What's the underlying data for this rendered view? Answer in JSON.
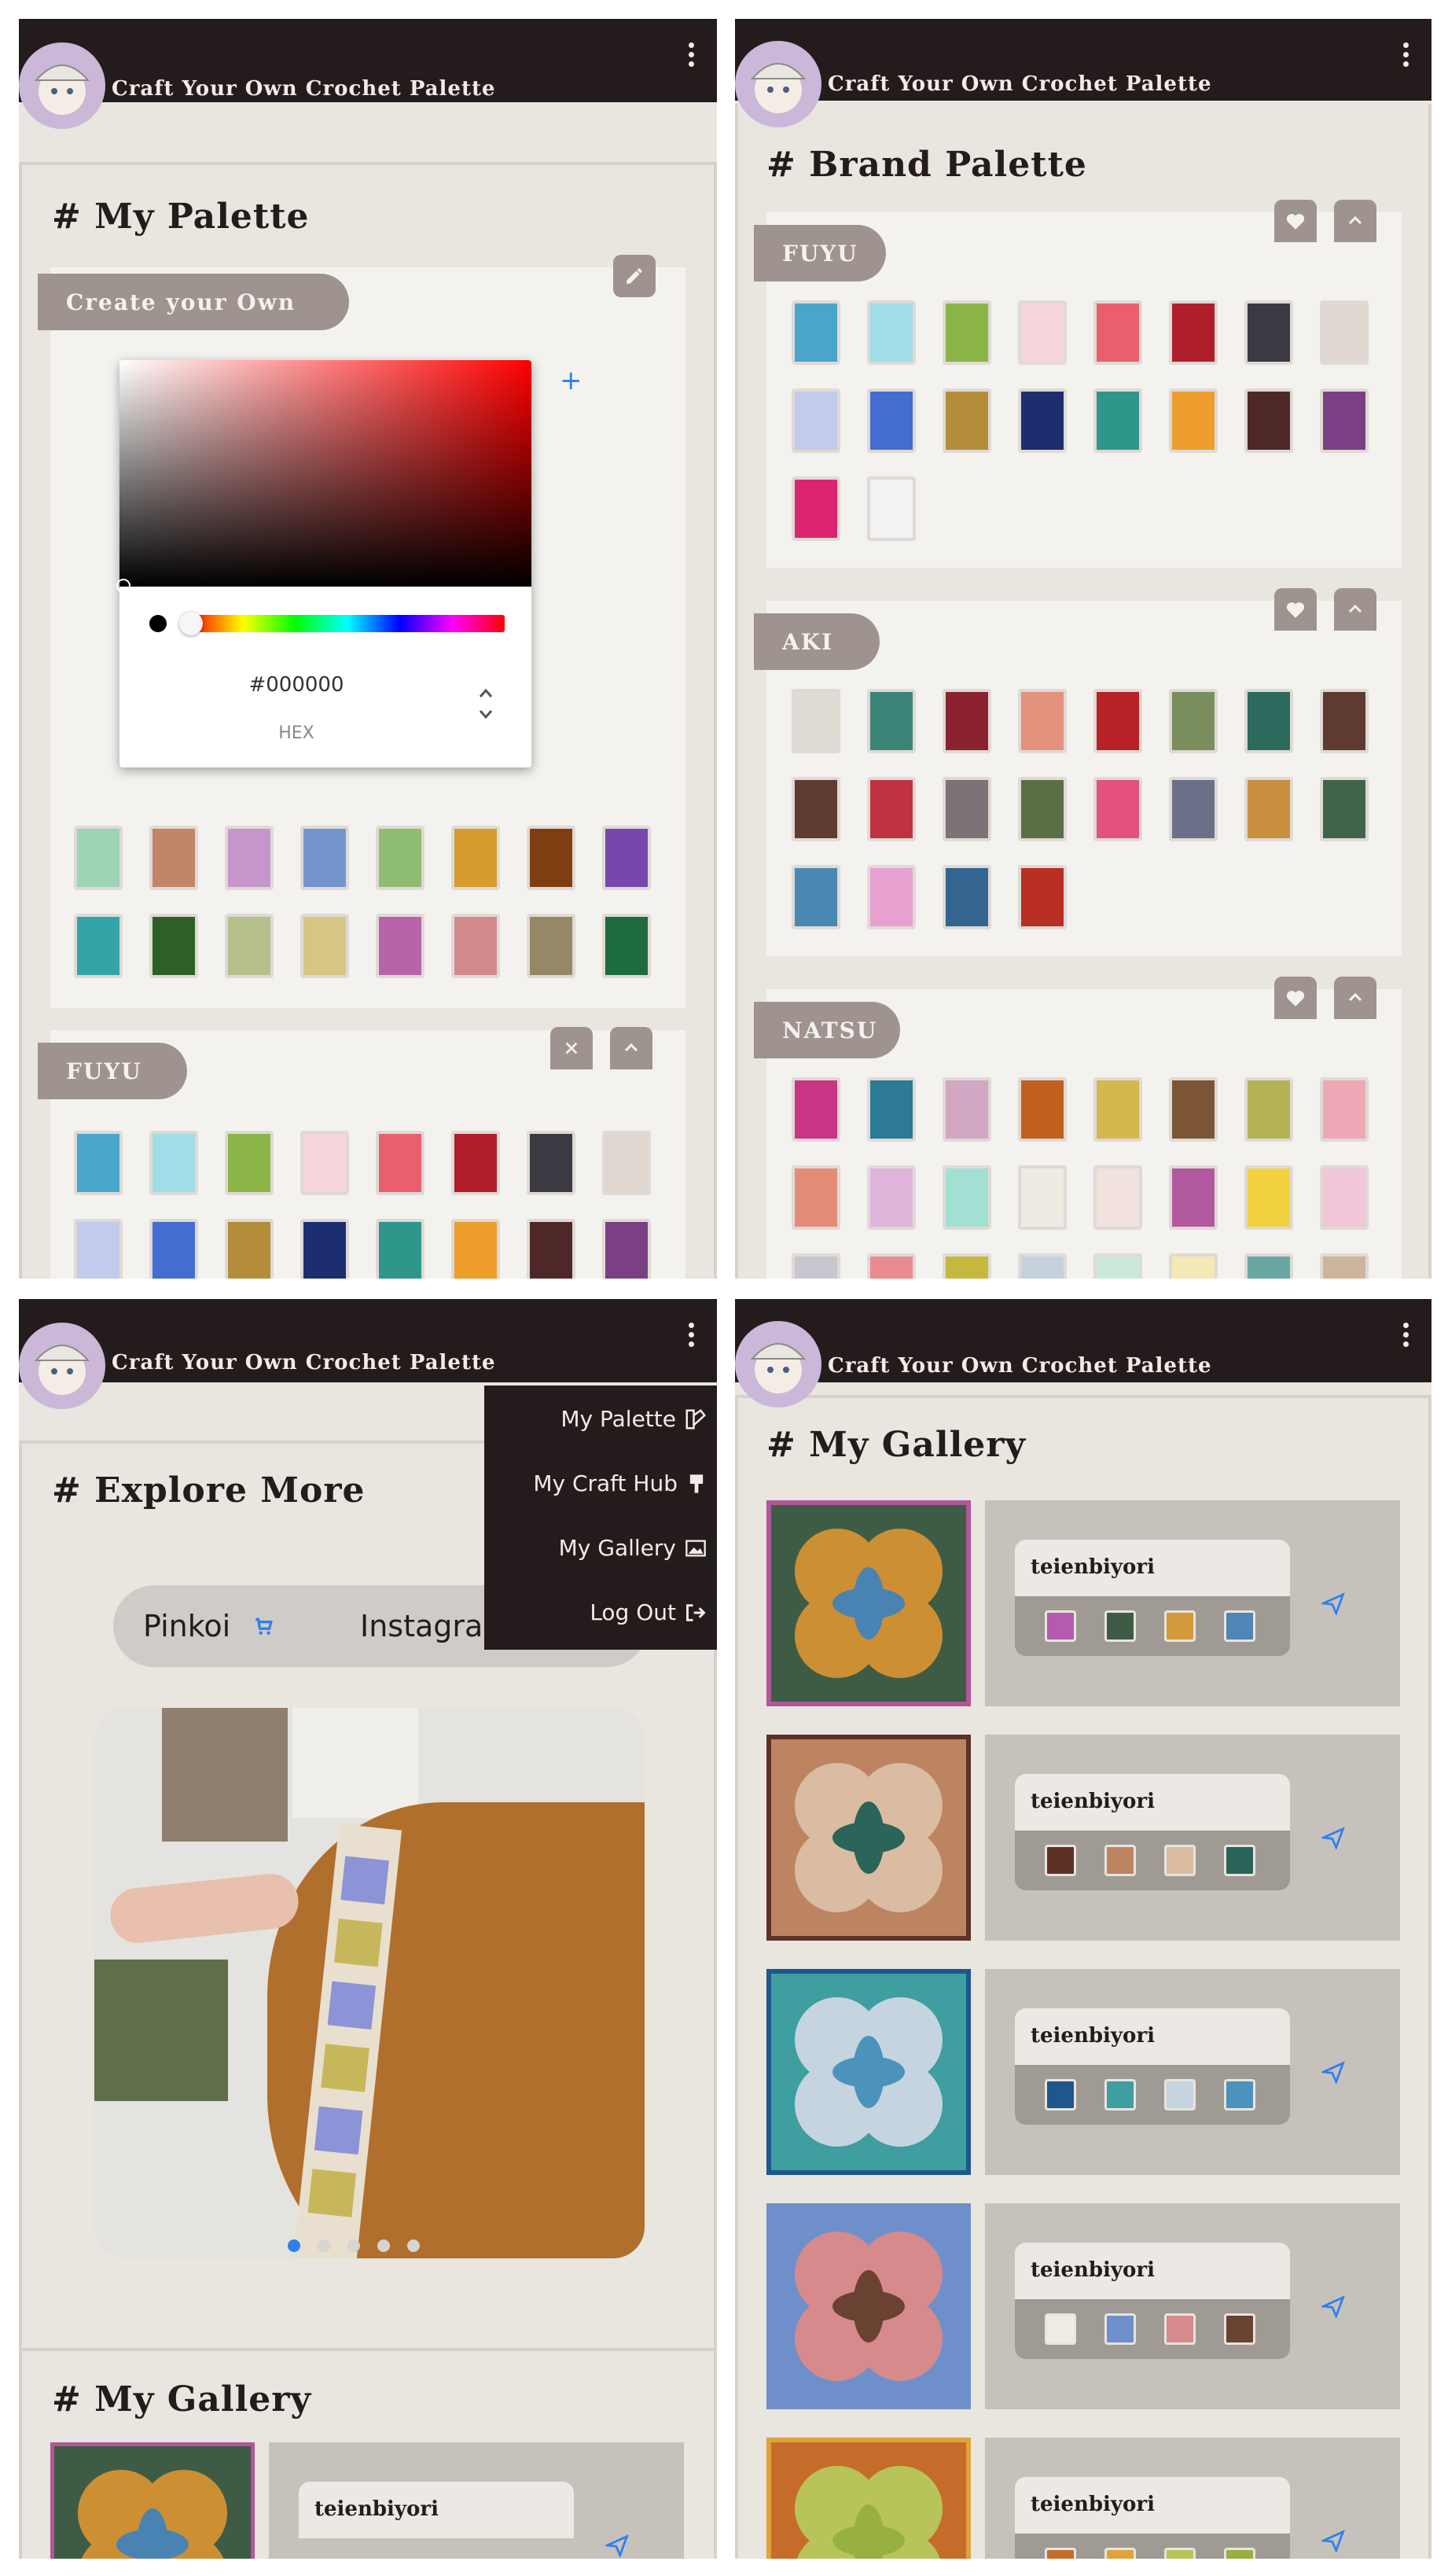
{
  "app": {
    "title": "Craft Your Own Crochet Palette"
  },
  "screen1": {
    "heading": "# My Palette",
    "create_label": "Create your Own",
    "picker": {
      "hex_value": "#000000",
      "mode_label": "HEX",
      "add_symbol": "+"
    },
    "custom_colors": [
      "#9ed3b6",
      "#c18567",
      "#c595cb",
      "#7395cb",
      "#8fbd72",
      "#d69b2c",
      "#7f3e12",
      "#7647ad",
      "#33a4a8",
      "#2e6025",
      "#b5c08c",
      "#d6c686",
      "#b963ab",
      "#d38a8c",
      "#968767",
      "#1e6b3d"
    ],
    "fuyu_label": "FUYU",
    "fuyu_colors": [
      "#4aa5cb",
      "#a1dde6",
      "#8bb447",
      "#f7d5dc",
      "#ea5f6d",
      "#b01e2c",
      "#3b3a42",
      "#e0d8d0",
      "#c2cbec",
      "#446dd2",
      "#b48d3a",
      "#1d2e70",
      "#2f968b",
      "#ed9e2c",
      "#4e2828",
      "#7a4083"
    ]
  },
  "screen2": {
    "heading": "# Brand Palette",
    "palettes": [
      {
        "label": "FUYU",
        "colors": [
          "#4aa5cb",
          "#a1dde6",
          "#8bb447",
          "#f7d5dc",
          "#ea5f6d",
          "#b01e2c",
          "#3b3a42",
          "#e0d8d0",
          "#c2cbec",
          "#446dd2",
          "#b48d3a",
          "#1d2e70",
          "#2f968b",
          "#ed9e2c",
          "#4e2828",
          "#7a4083",
          "#dc2570",
          "#f2f2f3"
        ]
      },
      {
        "label": "AKI",
        "colors": [
          "#dfdcd4",
          "#3d8478",
          "#8b2230",
          "#e3927e",
          "#b82226",
          "#7a8e5d",
          "#2d6a5e",
          "#5e3a30",
          "#5e3a30",
          "#bf3242",
          "#7c7277",
          "#5a6f45",
          "#e3517d",
          "#6a7087",
          "#c88f3e",
          "#3f644a",
          "#4b87b3",
          "#e7a1d1",
          "#336590",
          "#b82e23"
        ]
      },
      {
        "label": "NATSU",
        "colors": [
          "#c93484",
          "#2c7a93",
          "#d1a7c2",
          "#c1601e",
          "#d4b84e",
          "#7b5536",
          "#b6b356",
          "#eda8b6",
          "#e38c78",
          "#dfb5dc",
          "#a3e0d4",
          "#efebe3",
          "#f1e2dd",
          "#b2589e",
          "#f2d23f",
          "#f0c6d8",
          "#c8c6cf",
          "#ea8b90",
          "#c6b83f",
          "#c7d1dd",
          "#cbe9da",
          "#f3e8b6",
          "#6aa7a3",
          "#ccb59c"
        ]
      }
    ]
  },
  "screen3": {
    "heading": "# Explore More",
    "tabs": [
      "Pinkoi",
      "Instagram"
    ],
    "menu": [
      "My Palette",
      "My Craft Hub",
      "My Gallery",
      "Log Out"
    ],
    "gallery_heading": "# My Gallery",
    "preview_user": "teienbiyori"
  },
  "screen4": {
    "heading": "# My Gallery",
    "items": [
      {
        "user": "teienbiyori",
        "frame": "#b15699",
        "bg": "#3e5c45",
        "petals": "#cd8f33",
        "center": "#4983b2",
        "colors": [
          "#b45bb0",
          "#3e5c45",
          "#d29a3a",
          "#4f86b5"
        ]
      },
      {
        "user": "teienbiyori",
        "frame": "#5e3126",
        "bg": "#bd8462",
        "petals": "#d9bca2",
        "center": "#2b6458",
        "colors": [
          "#5e3126",
          "#bd8462",
          "#d9bca2",
          "#2b6458"
        ]
      },
      {
        "user": "teienbiyori",
        "frame": "#1f568c",
        "bg": "#3e9ea0",
        "petals": "#c6d4e0",
        "center": "#4b93bb",
        "colors": [
          "#1f568c",
          "#3e9ea0",
          "#c6d4e0",
          "#4b93bb"
        ]
      },
      {
        "user": "teienbiyori",
        "frame": "#6f8fcb",
        "bg": "#6f8fcb",
        "petals": "#d68a8b",
        "center": "#6a4232",
        "colors": [
          "#efebe5",
          "#6f8fcb",
          "#d68a8b",
          "#6a4232"
        ]
      },
      {
        "user": "teienbiyori",
        "frame": "#e0a23c",
        "bg": "#c66c2a",
        "petals": "#b8c45a",
        "center": "#98b042",
        "colors": [
          "#c66c2a",
          "#e0a23c",
          "#b8c45a",
          "#98b042"
        ]
      }
    ]
  }
}
